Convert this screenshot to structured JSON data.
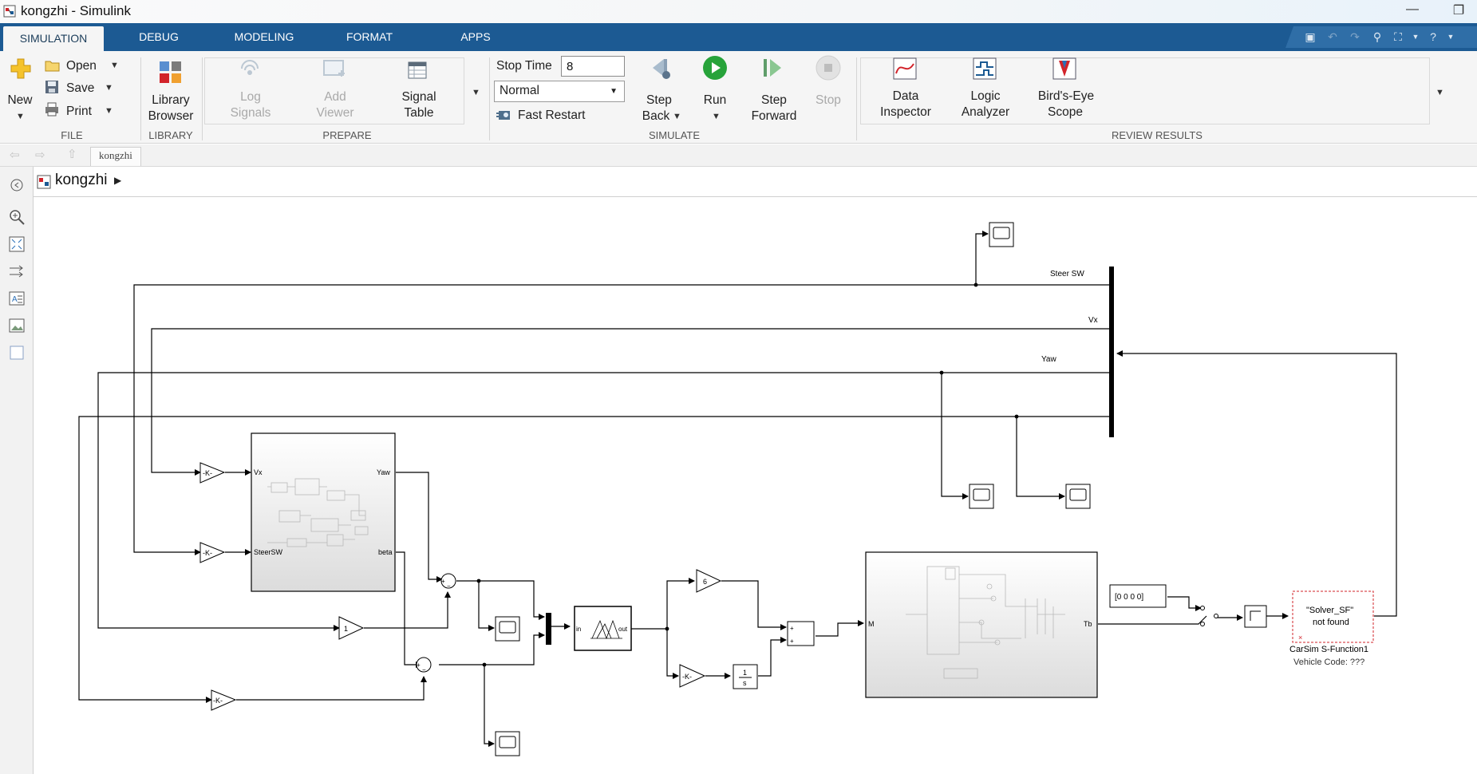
{
  "window": {
    "title": "kongzhi - Simulink",
    "minimize": "—",
    "restore": "❐"
  },
  "tabs": [
    "SIMULATION",
    "DEBUG",
    "MODELING",
    "FORMAT",
    "APPS"
  ],
  "ribbon": {
    "file": {
      "new": "New",
      "open": "Open",
      "save": "Save",
      "print": "Print",
      "section": "FILE"
    },
    "library": {
      "label1": "Library",
      "label2": "Browser",
      "section": "LIBRARY"
    },
    "prepare": {
      "log1": "Log",
      "log2": "Signals",
      "add1": "Add",
      "add2": "Viewer",
      "sig1": "Signal",
      "sig2": "Table",
      "section": "PREPARE"
    },
    "simulate": {
      "stop_time_label": "Stop Time",
      "stop_time_value": "8",
      "mode": "Normal",
      "fast_restart": "Fast Restart",
      "step_back1": "Step",
      "step_back2": "Back",
      "run": "Run",
      "step_fwd1": "Step",
      "step_fwd2": "Forward",
      "stop": "Stop",
      "section": "SIMULATE"
    },
    "review": {
      "di1": "Data",
      "di2": "Inspector",
      "la1": "Logic",
      "la2": "Analyzer",
      "be1": "Bird's-Eye",
      "be2": "Scope",
      "section": "REVIEW RESULTS"
    }
  },
  "nav": {
    "breadcrumb_tab": "kongzhi"
  },
  "path": {
    "model": "kongzhi"
  },
  "diagram": {
    "bus_labels": {
      "steer": "Steer SW",
      "vx": "Vx",
      "yaw": "Yaw"
    },
    "gain_k": "-K-",
    "gain_one": "1",
    "gain_six": "6",
    "subsystem1": {
      "in1": "Vx",
      "in2": "SteerSW",
      "out1": "Yaw",
      "out2": "beta"
    },
    "fuzzy": {
      "in": "in",
      "out": "out"
    },
    "subsystem2": {
      "in": "M",
      "out": "Tb"
    },
    "constant": "[0 0 0 0]",
    "sfun": {
      "line1": "\"Solver_SF\"",
      "line2": "not found",
      "name": "CarSim S-Function1",
      "code": "Vehicle Code: ???"
    },
    "integrator_num": "1",
    "integrator_den": "s"
  },
  "colors": {
    "tab_blue": "#1c5a93",
    "run_green": "#27a33a"
  }
}
